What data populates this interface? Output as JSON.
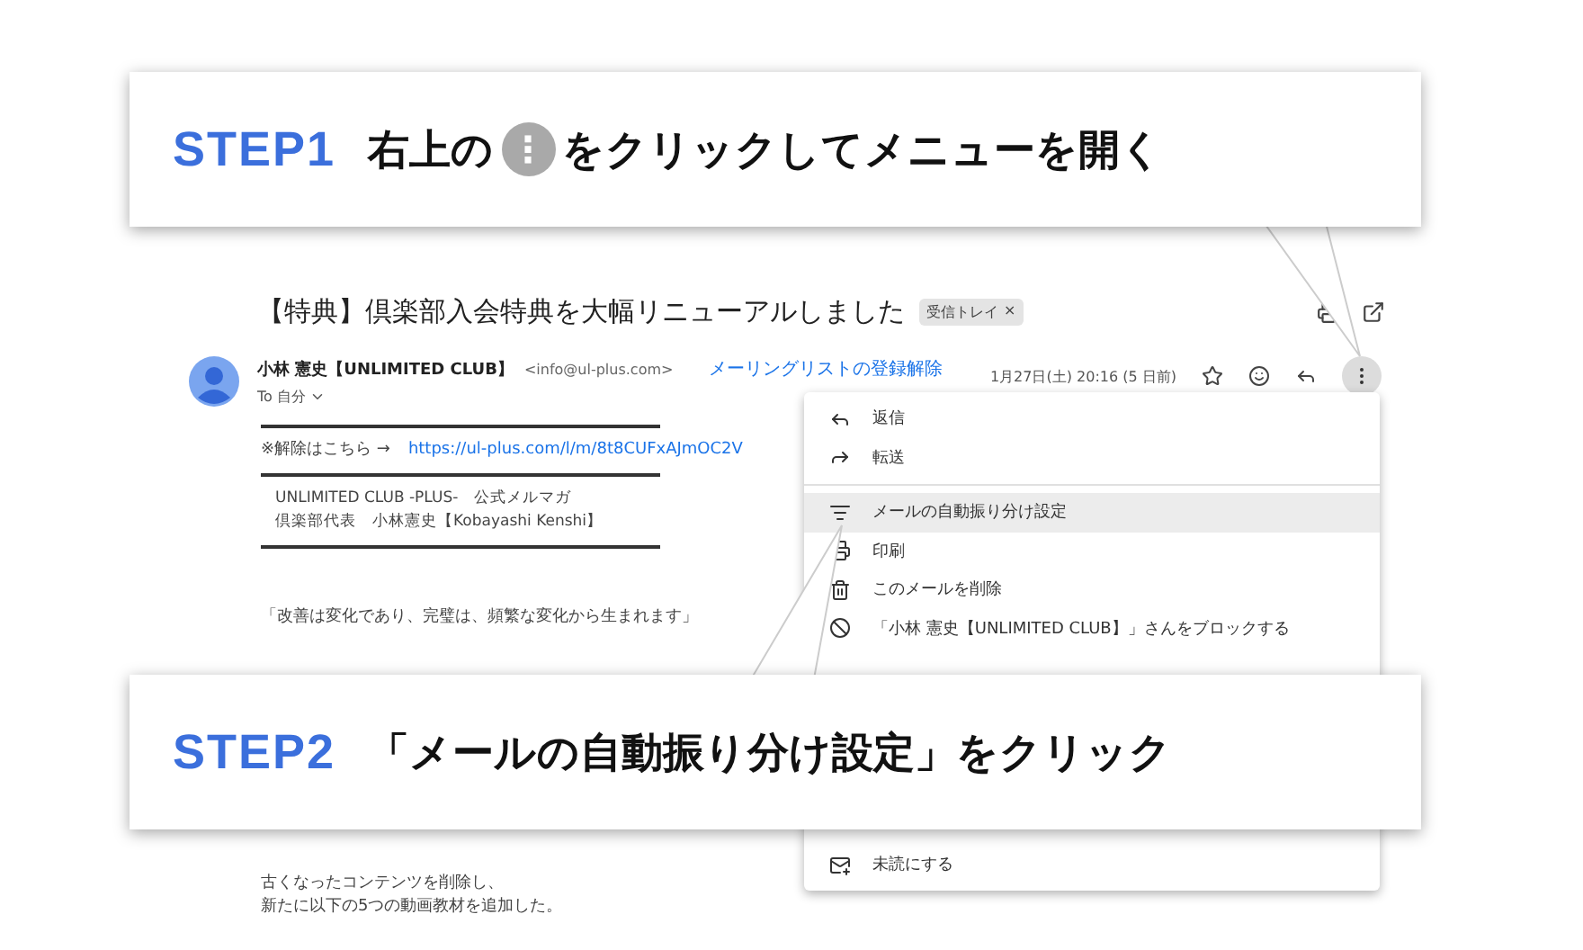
{
  "email": {
    "subject": "【特典】倶楽部入会特典を大幅リニューアルしました",
    "label": "受信トレイ",
    "label_close": "×",
    "sender_name": "小林 憲史【UNLIMITED CLUB】",
    "sender_email": "<info@ul-plus.com>",
    "unsubscribe": "メーリングリストの登録解除",
    "date": "1月27日(土) 20:16 (5 日前)",
    "recipient": "To 自分",
    "body_top": [
      {
        "kind": "rule"
      },
      {
        "kind": "link_line",
        "text": "※解除はこちら →",
        "link": "https://ul-plus.com/l/m/8t8CUFxAJmOC2V"
      },
      {
        "kind": "rule"
      },
      {
        "kind": "signature",
        "text": "UNLIMITED CLUB -PLUS-　公式メルマガ"
      },
      {
        "kind": "signature",
        "text": "倶楽部代表　小林憲史【Kobayashi Kenshi】"
      },
      {
        "kind": "rule"
      },
      {
        "kind": "paragraph",
        "text": "「改善は変化であり、完璧は、頻繁な変化から生まれます」"
      }
    ],
    "body_bottom": [
      {
        "kind": "text",
        "text": "古くなったコンテンツを削除し、"
      },
      {
        "kind": "text",
        "text": "新たに以下の5つの動画教材を追加した。"
      }
    ]
  },
  "menu": {
    "top": [
      {
        "kind": "item",
        "label": "返信",
        "selected": false
      },
      {
        "kind": "item",
        "label": "転送",
        "selected": false
      },
      {
        "kind": "divider"
      },
      {
        "kind": "item",
        "label": "メールの自動振り分け設定",
        "selected": true
      },
      {
        "kind": "item",
        "label": "印刷",
        "selected": false
      },
      {
        "kind": "item",
        "label": "このメールを削除",
        "selected": false
      },
      {
        "kind": "item",
        "label": "「小林 憲史【UNLIMITED CLUB】」さんをブロックする",
        "selected": false
      }
    ],
    "bottom": [
      {
        "kind": "item",
        "label": "未読にする",
        "selected": false
      }
    ]
  },
  "callouts": [
    {
      "step": "STEP1",
      "segments": [
        {
          "kind": "text",
          "text": "右上の"
        },
        {
          "kind": "key",
          "text": "⋮"
        },
        {
          "kind": "text",
          "text": "をクリックしてメニューを開く"
        }
      ]
    },
    {
      "step": "STEP2",
      "segments": [
        {
          "kind": "text",
          "text": "「メールの自動振り分け設定」をクリック"
        }
      ]
    }
  ]
}
